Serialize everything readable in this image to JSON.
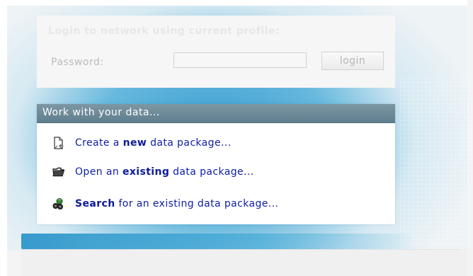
{
  "login": {
    "title": "Login to network using current profile:",
    "password_label": "Password:",
    "password_value": "",
    "button_label": "login"
  },
  "data_panel": {
    "header": "Work with your data...",
    "actions": [
      {
        "pre": "Create a ",
        "bold": "new",
        "post": " data package...",
        "icon": "new-document-icon"
      },
      {
        "pre": "Open an ",
        "bold": "existing",
        "post": " data package...",
        "icon": "open-folder-icon"
      },
      {
        "pre": "",
        "bold": "Search",
        "post": " for an existing data package...",
        "icon": "binoculars-icon"
      }
    ]
  },
  "colors": {
    "link": "#1020a8",
    "header_bg": "#6b8796",
    "glow": "#2f9ad0"
  }
}
